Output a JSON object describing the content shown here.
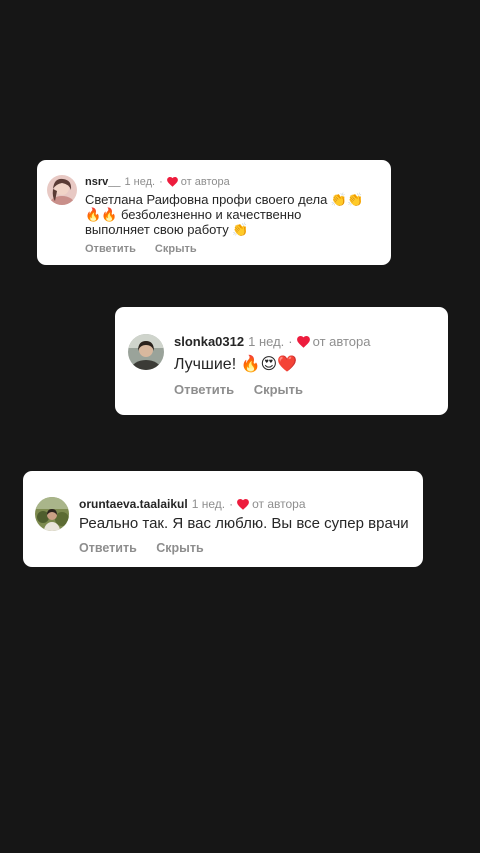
{
  "colors": {
    "background": "#161616",
    "card": "#ffffff",
    "text": "#262626",
    "muted": "#8e8e8e",
    "heart": "#ed1c3d"
  },
  "comments": [
    {
      "username": "nsrv__",
      "time": "1 нед.",
      "separator": "·",
      "liked_label": "от автора",
      "liked_icon": "heart-icon",
      "text_lines": [
        "Светлана Раифовна профи своего дела 👏👏",
        "🔥🔥 безболезненно и качественно",
        "выполняет свою работу 👏"
      ],
      "reply_label": "Ответить",
      "hide_label": "Скрыть"
    },
    {
      "username": "slonka0312",
      "time": "1 нед.",
      "separator": "·",
      "liked_label": "от автора",
      "liked_icon": "heart-icon",
      "text_lines": [
        "Лучшие! 🔥😍❤️"
      ],
      "reply_label": "Ответить",
      "hide_label": "Скрыть"
    },
    {
      "username": "oruntaeva.taalaikul",
      "time": "1 нед.",
      "separator": "·",
      "liked_label": "от автора",
      "liked_icon": "heart-icon",
      "text_lines": [
        "Реально так. Я вас люблю. Вы все супер врачи"
      ],
      "reply_label": "Ответить",
      "hide_label": "Скрыть"
    }
  ]
}
